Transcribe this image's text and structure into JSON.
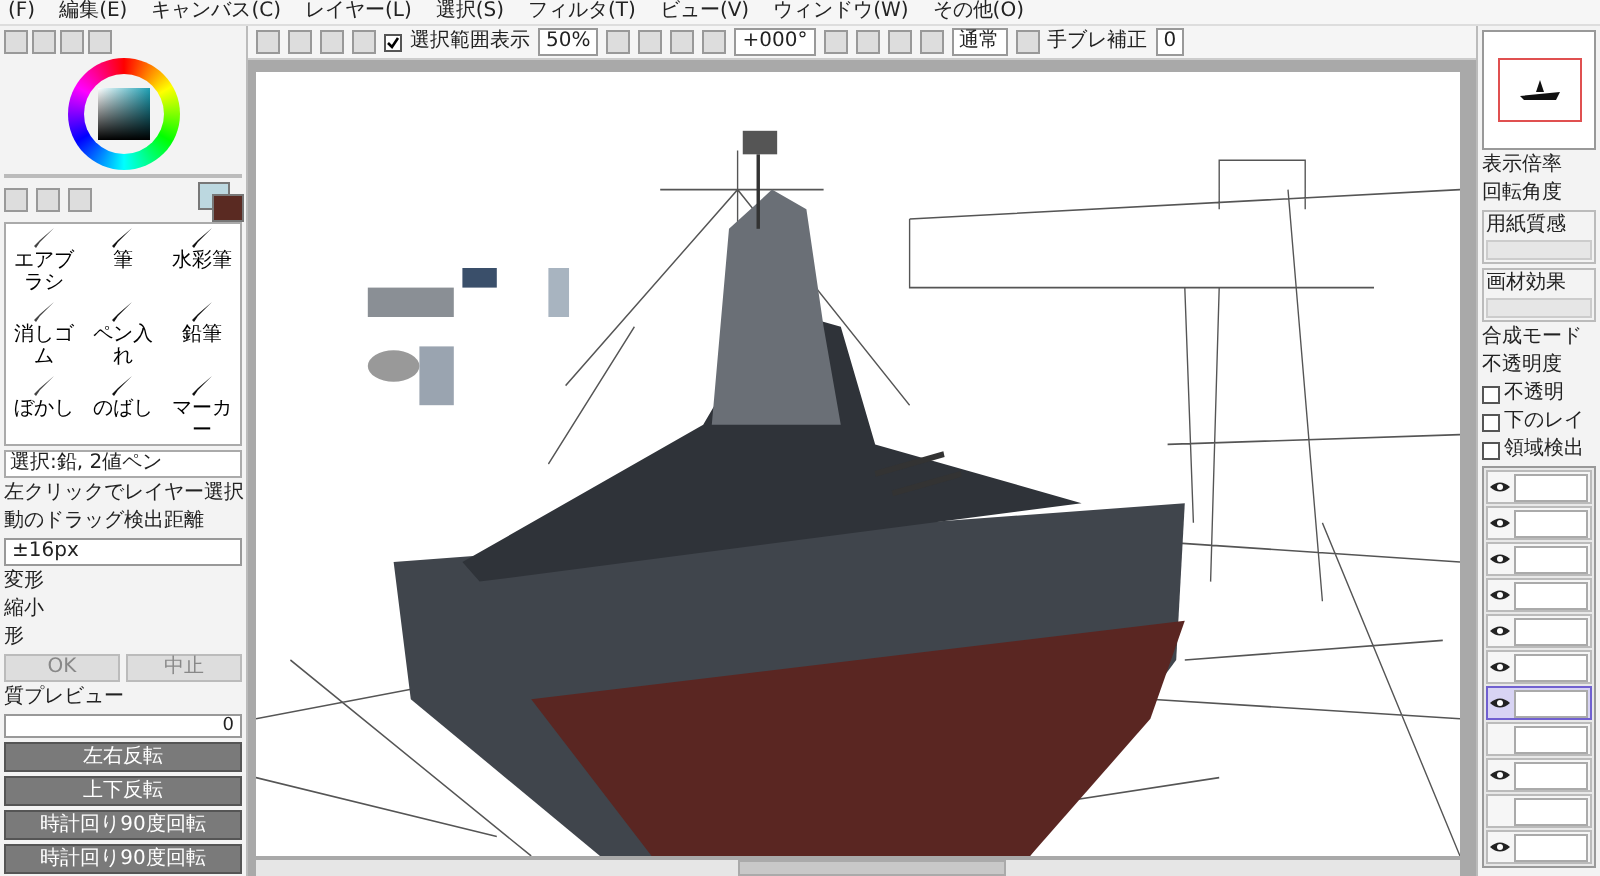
{
  "menu": [
    "(F)",
    "編集(E)",
    "キャンバス(C)",
    "レイヤー(L)",
    "選択(S)",
    "フィルタ(T)",
    "ビュー(V)",
    "ウィンドウ(W)",
    "その他(O)"
  ],
  "toolbar": {
    "selection_show": {
      "label": "選択範囲表示",
      "checked": true
    },
    "zoom": "50%",
    "rotation": "+000°",
    "blend": "通常",
    "stabilizer_label": "手ブレ補正",
    "stabilizer": "0"
  },
  "tools": [
    {
      "label": "エアブラシ",
      "selected": false
    },
    {
      "label": "筆",
      "selected": false
    },
    {
      "label": "水彩筆",
      "selected": false
    },
    {
      "label": "消しゴム",
      "selected": false
    },
    {
      "label": "ペン入れ",
      "selected": false
    },
    {
      "label": "鉛筆",
      "selected": false
    },
    {
      "label": "ぼかし",
      "selected": false
    },
    {
      "label": "のばし",
      "selected": false
    },
    {
      "label": "マーカー",
      "selected": false
    }
  ],
  "tool_status": "選択:鉛, 2値ペン",
  "options": [
    {
      "kind": "text",
      "label": "左クリックでレイヤー選択"
    },
    {
      "kind": "text",
      "label": "動のドラッグ検出距離"
    },
    {
      "kind": "field",
      "label": "±16px"
    },
    {
      "kind": "text",
      "label": "変形"
    },
    {
      "kind": "text",
      "label": "縮小"
    },
    {
      "kind": "text",
      "label": "形"
    }
  ],
  "action_buttons": [
    "OK",
    "中止"
  ],
  "preview": {
    "label": "質プレビュー",
    "value": "0"
  },
  "transform_buttons": [
    "左右反転",
    "上下反転",
    "時計回り90度回転",
    "時計回り90度回転"
  ],
  "right_labels": [
    "表示倍率",
    "回転角度"
  ],
  "right_fields": [
    "用紙質感",
    "画材効果"
  ],
  "blend_mode_label": "合成モード",
  "opacity_label": "不透明度",
  "layer_options": [
    {
      "label": "不透明",
      "checked": false
    },
    {
      "label": "下のレイ",
      "checked": false
    },
    {
      "label": "領域検出",
      "checked": false
    }
  ],
  "layers": [
    {
      "visible": true,
      "selected": false
    },
    {
      "visible": true,
      "selected": false
    },
    {
      "visible": true,
      "selected": false
    },
    {
      "visible": true,
      "selected": false
    },
    {
      "visible": true,
      "selected": false
    },
    {
      "visible": true,
      "selected": false
    },
    {
      "visible": true,
      "selected": true
    },
    {
      "visible": false,
      "selected": false
    },
    {
      "visible": true,
      "selected": false
    },
    {
      "visible": false,
      "selected": false
    },
    {
      "visible": true,
      "selected": false
    }
  ]
}
